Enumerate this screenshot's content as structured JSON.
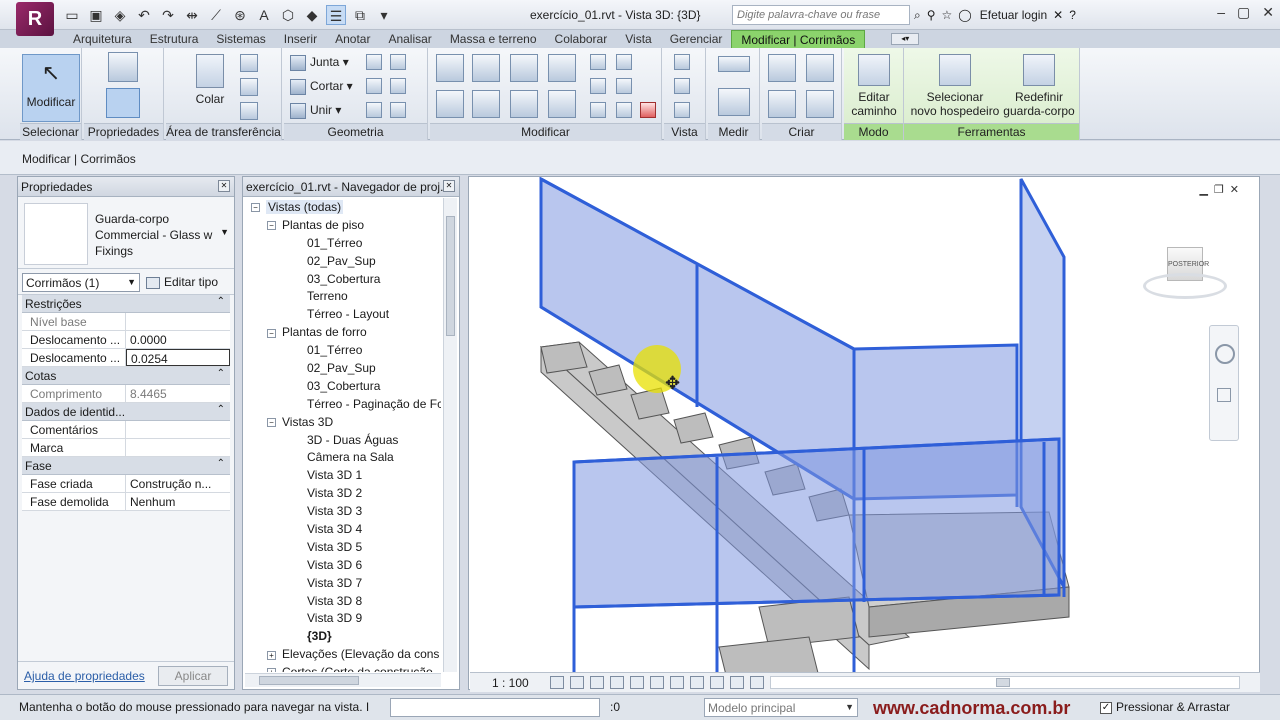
{
  "titlebar": {
    "logo": "R",
    "title": "exercício_01.rvt - Vista 3D: {3D}",
    "search_placeholder": "Digite palavra-chave ou frase",
    "login": "Efetuar login"
  },
  "tabs": [
    "Arquitetura",
    "Estrutura",
    "Sistemas",
    "Inserir",
    "Anotar",
    "Analisar",
    "Massa e terreno",
    "Colaborar",
    "Vista",
    "Gerenciar",
    "Modificar | Corrimãos"
  ],
  "active_tab": "Modificar | Corrimãos",
  "ribbon": {
    "panels": {
      "selecionar": "Selecionar",
      "propriedades": "Propriedades",
      "area": "Área de transferência",
      "geometria": "Geometria",
      "modificar": "Modificar",
      "vista": "Vista",
      "medir": "Medir",
      "criar": "Criar",
      "modo": "Modo",
      "ferramentas": "Ferramentas"
    },
    "modificar_btn": "Modificar",
    "colar_btn": "Colar",
    "junta": "Junta",
    "cortar": "Cortar",
    "unir": "Unir",
    "editar_caminho": [
      "Editar",
      "caminho"
    ],
    "selecionar_hospedeiro": [
      "Selecionar",
      "novo hospedeiro"
    ],
    "redefinir": [
      "Redefinir",
      "guarda-corpo"
    ]
  },
  "optionsbar": {
    "context": "Modificar | Corrimãos"
  },
  "properties": {
    "title": "Propriedades",
    "type_name": [
      "Guarda-corpo",
      "Commercial - Glass w",
      "Fixings"
    ],
    "instance_selector": "Corrimãos (1)",
    "edit_type": "Editar tipo",
    "groups": [
      {
        "name": "Restrições",
        "rows": [
          {
            "name": "Nível base",
            "value": "",
            "disabled": true
          },
          {
            "name": "Deslocamento ...",
            "value": "0.0000",
            "disabled": false
          },
          {
            "name": "Deslocamento ...",
            "value": "0.0254",
            "disabled": false,
            "editing": true
          }
        ]
      },
      {
        "name": "Cotas",
        "rows": [
          {
            "name": "Comprimento",
            "value": "8.4465",
            "disabled": true
          }
        ]
      },
      {
        "name": "Dados de identid...",
        "rows": [
          {
            "name": "Comentários",
            "value": "",
            "disabled": false
          },
          {
            "name": "Marca",
            "value": "",
            "disabled": false
          }
        ]
      },
      {
        "name": "Fase",
        "rows": [
          {
            "name": "Fase criada",
            "value": "Construção n...",
            "disabled": false
          },
          {
            "name": "Fase demolida",
            "value": "Nenhum",
            "disabled": false
          }
        ]
      }
    ],
    "help_link": "Ajuda de propriedades",
    "apply": "Aplicar"
  },
  "browser": {
    "title": "exercício_01.rvt - Navegador de proj...",
    "items": [
      {
        "label": "Vistas (todas)",
        "level": 0,
        "toggle": "−",
        "selected": true
      },
      {
        "label": "Plantas de piso",
        "level": 1,
        "toggle": "−"
      },
      {
        "label": "01_Térreo",
        "level": 2
      },
      {
        "label": "02_Pav_Sup",
        "level": 2
      },
      {
        "label": "03_Cobertura",
        "level": 2
      },
      {
        "label": "Terreno",
        "level": 2
      },
      {
        "label": "Térreo - Layout",
        "level": 2
      },
      {
        "label": "Plantas de forro",
        "level": 1,
        "toggle": "−"
      },
      {
        "label": "01_Térreo",
        "level": 2
      },
      {
        "label": "02_Pav_Sup",
        "level": 2
      },
      {
        "label": "03_Cobertura",
        "level": 2
      },
      {
        "label": "Térreo - Paginação de Fc",
        "level": 2
      },
      {
        "label": "Vistas 3D",
        "level": 1,
        "toggle": "−"
      },
      {
        "label": "3D - Duas Águas",
        "level": 2
      },
      {
        "label": "Câmera na Sala",
        "level": 2
      },
      {
        "label": "Vista 3D 1",
        "level": 2
      },
      {
        "label": "Vista 3D 2",
        "level": 2
      },
      {
        "label": "Vista 3D 3",
        "level": 2
      },
      {
        "label": "Vista 3D 4",
        "level": 2
      },
      {
        "label": "Vista 3D 5",
        "level": 2
      },
      {
        "label": "Vista 3D 6",
        "level": 2
      },
      {
        "label": "Vista 3D 7",
        "level": 2
      },
      {
        "label": "Vista 3D 8",
        "level": 2
      },
      {
        "label": "Vista 3D 9",
        "level": 2
      },
      {
        "label": "{3D}",
        "level": 2,
        "bold": true
      },
      {
        "label": "Elevações (Elevação da cons",
        "level": 1,
        "toggle": "+"
      },
      {
        "label": "Cortes (Corte da construção",
        "level": 1,
        "toggle": "+"
      }
    ]
  },
  "viewcube": {
    "label": "POSTERIOR"
  },
  "viewbar": {
    "scale": "1 : 100"
  },
  "status": {
    "message": "Mantenha o botão do mouse pressionado para navegar na vista. I",
    "filter_count": ":0",
    "model": "Modelo principal",
    "watermark": "www.cadnorma.com.br",
    "press_drag": "Pressionar & Arrastar"
  },
  "colors": {
    "accent_green": "#8bd36c",
    "rail_blue": "#2f5fd8",
    "glass": "#7f98e0",
    "stair": "#c8c8c8"
  }
}
